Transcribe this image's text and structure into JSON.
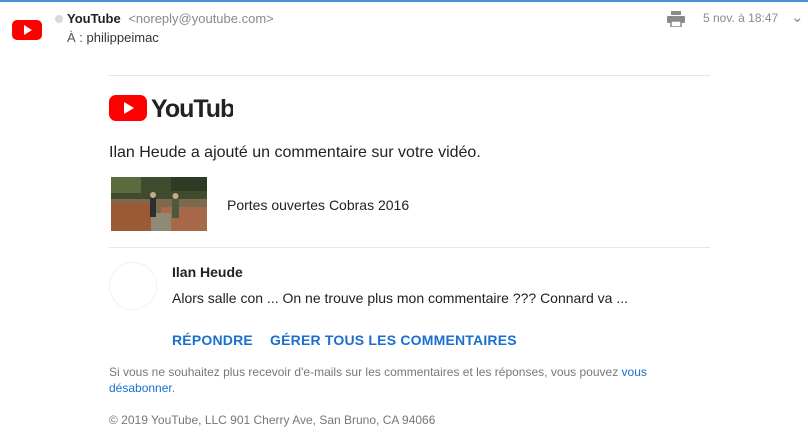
{
  "header": {
    "sender_name": "YouTube",
    "sender_email": "<noreply@youtube.com>",
    "to_label": "À :",
    "to_value": "philippeimac",
    "date": "5 nov. à 18:47"
  },
  "email": {
    "brand": "YouTube",
    "headline": "Ilan Heude a ajouté un commentaire sur votre vidéo.",
    "video_title": "Portes ouvertes Cobras 2016",
    "comment": {
      "author": "Ilan Heude",
      "text": "Alors salle con ... On ne trouve plus mon commentaire ??? Connard va ..."
    },
    "actions": {
      "reply": "RÉPONDRE",
      "manage": "GÉRER TOUS LES COMMENTAIRES"
    },
    "footer": {
      "text": "Si vous ne souhaitez plus recevoir d'e-mails sur les commentaires et les réponses, vous pouvez",
      "link": "vous désabonner",
      "suffix": "."
    },
    "copyright": "© 2019 YouTube, LLC 901 Cherry Ave, San Bruno, CA 94066"
  },
  "colors": {
    "accent": "#4a90d9",
    "youtube_red": "#ff0000",
    "link": "#1a6fcf"
  },
  "icons": [
    "youtube-icon",
    "print-icon",
    "chevron-down-icon"
  ]
}
